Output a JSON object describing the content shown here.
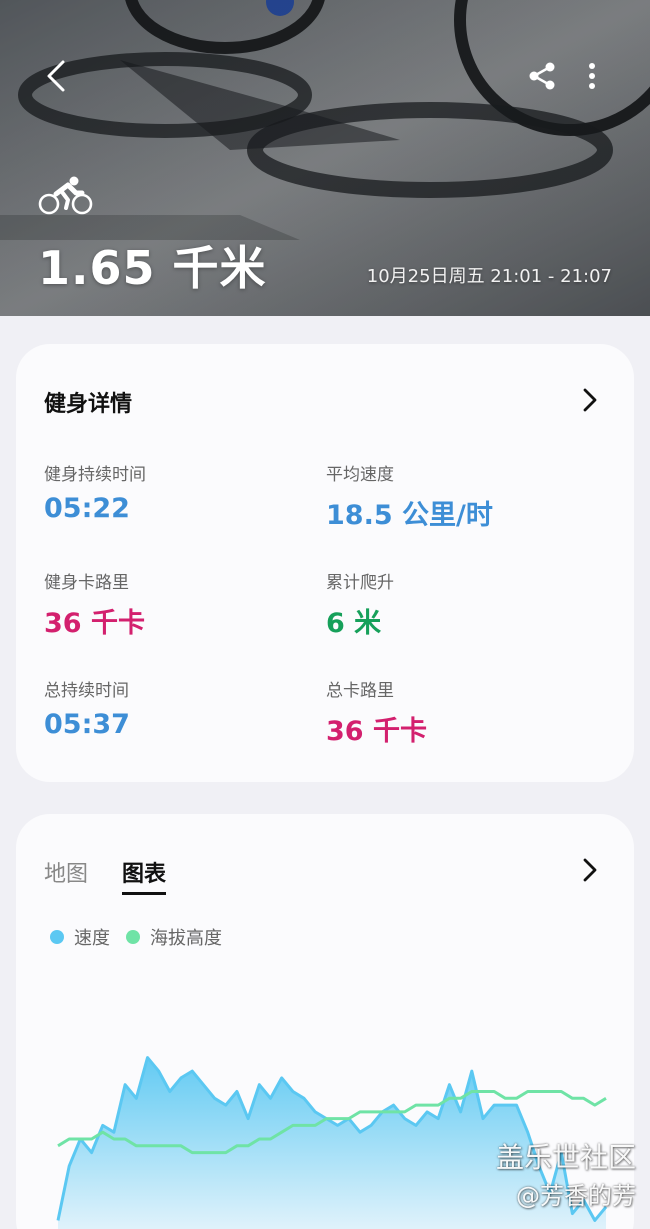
{
  "hero": {
    "distance": "1.65 千米",
    "datetime": "10月25日周五 21:01 - 21:07",
    "activity_icon": "cycling-icon"
  },
  "details": {
    "title": "健身详情",
    "stats": [
      {
        "label": "健身持续时间",
        "value": "05:22",
        "color": "#3d8ed6"
      },
      {
        "label": "平均速度",
        "value": "18.5 公里/时",
        "color": "#3d8ed6"
      },
      {
        "label": "健身卡路里",
        "value": "36 千卡",
        "color": "#d3206e"
      },
      {
        "label": "累计爬升",
        "value": "6 米",
        "color": "#16a05a"
      },
      {
        "label": "总持续时间",
        "value": "05:37",
        "color": "#3d8ed6"
      },
      {
        "label": "总卡路里",
        "value": "36 千卡",
        "color": "#d3206e"
      }
    ]
  },
  "chart_card": {
    "tabs": [
      {
        "label": "地图",
        "active": false
      },
      {
        "label": "图表",
        "active": true
      }
    ],
    "legend": [
      {
        "label": "速度",
        "color": "#5bc8f2"
      },
      {
        "label": "海拔高度",
        "color": "#6fe3a6"
      }
    ]
  },
  "chart_data": {
    "type": "area",
    "series": [
      {
        "name": "速度",
        "color": "#5bc8f2",
        "values": [
          2,
          10,
          14,
          12,
          16,
          15,
          22,
          20,
          26,
          24,
          21,
          23,
          24,
          22,
          20,
          19,
          21,
          17,
          22,
          20,
          23,
          21,
          20,
          18,
          17,
          16,
          17,
          15,
          16,
          18,
          19,
          17,
          16,
          18,
          17,
          22,
          18,
          24,
          17,
          19,
          19,
          19,
          15,
          10,
          6,
          12,
          3,
          5,
          2,
          4
        ]
      },
      {
        "name": "海拔高度",
        "color": "#6fe3a6",
        "values": [
          13,
          14,
          14,
          14,
          15,
          14,
          14,
          13,
          13,
          13,
          13,
          13,
          12,
          12,
          12,
          12,
          13,
          13,
          14,
          14,
          15,
          16,
          16,
          16,
          17,
          17,
          17,
          18,
          18,
          18,
          18,
          18,
          19,
          19,
          19,
          20,
          20,
          21,
          21,
          21,
          20,
          20,
          21,
          21,
          21,
          21,
          20,
          20,
          19,
          20
        ]
      }
    ]
  },
  "watermark": {
    "line1": "盖乐世社区",
    "line2": "@芳香的芳"
  }
}
